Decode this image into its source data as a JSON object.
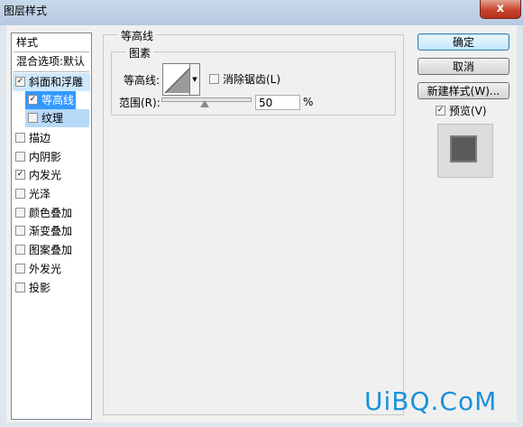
{
  "window": {
    "title": "图层样式",
    "close_glyph": "x"
  },
  "left_panel": {
    "styles_header": "样式",
    "blend_options": "混合选项:默认",
    "items": [
      {
        "label": "斜面和浮雕",
        "checked": true
      },
      {
        "label": "等高线",
        "checked": true
      },
      {
        "label": "纹理",
        "checked": false
      },
      {
        "label": "描边",
        "checked": false
      },
      {
        "label": "内阴影",
        "checked": false
      },
      {
        "label": "内发光",
        "checked": true
      },
      {
        "label": "光泽",
        "checked": false
      },
      {
        "label": "颜色叠加",
        "checked": false
      },
      {
        "label": "渐变叠加",
        "checked": false
      },
      {
        "label": "图案叠加",
        "checked": false
      },
      {
        "label": "外发光",
        "checked": false
      },
      {
        "label": "投影",
        "checked": false
      }
    ]
  },
  "contour_panel": {
    "group_title": "等高线",
    "subgroup_title": "图素",
    "contour_label": "等高线:",
    "antialias_label": "消除锯齿(L)",
    "antialias_checked": false,
    "range_label": "范围(R):",
    "range_value": "50",
    "range_unit": "%"
  },
  "right_panel": {
    "ok_label": "确定",
    "cancel_label": "取消",
    "new_style_label": "新建样式(W)...",
    "preview_label": "预览(V)",
    "preview_checked": true
  },
  "watermark": "UiBQ.CoM"
}
